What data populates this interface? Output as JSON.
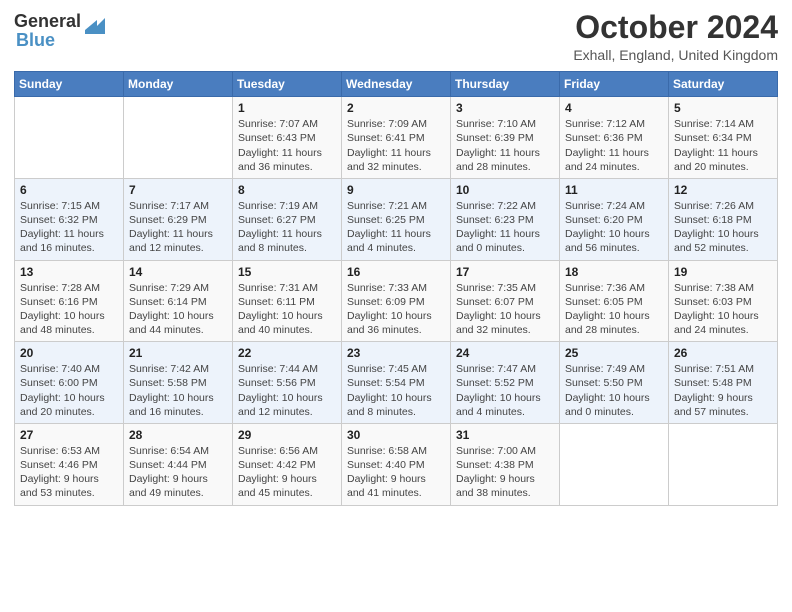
{
  "header": {
    "logo_line1": "General",
    "logo_line2": "Blue",
    "month": "October 2024",
    "location": "Exhall, England, United Kingdom"
  },
  "weekdays": [
    "Sunday",
    "Monday",
    "Tuesday",
    "Wednesday",
    "Thursday",
    "Friday",
    "Saturday"
  ],
  "weeks": [
    [
      {
        "day": "",
        "info": ""
      },
      {
        "day": "",
        "info": ""
      },
      {
        "day": "1",
        "info": "Sunrise: 7:07 AM\nSunset: 6:43 PM\nDaylight: 11 hours and 36 minutes."
      },
      {
        "day": "2",
        "info": "Sunrise: 7:09 AM\nSunset: 6:41 PM\nDaylight: 11 hours and 32 minutes."
      },
      {
        "day": "3",
        "info": "Sunrise: 7:10 AM\nSunset: 6:39 PM\nDaylight: 11 hours and 28 minutes."
      },
      {
        "day": "4",
        "info": "Sunrise: 7:12 AM\nSunset: 6:36 PM\nDaylight: 11 hours and 24 minutes."
      },
      {
        "day": "5",
        "info": "Sunrise: 7:14 AM\nSunset: 6:34 PM\nDaylight: 11 hours and 20 minutes."
      }
    ],
    [
      {
        "day": "6",
        "info": "Sunrise: 7:15 AM\nSunset: 6:32 PM\nDaylight: 11 hours and 16 minutes."
      },
      {
        "day": "7",
        "info": "Sunrise: 7:17 AM\nSunset: 6:29 PM\nDaylight: 11 hours and 12 minutes."
      },
      {
        "day": "8",
        "info": "Sunrise: 7:19 AM\nSunset: 6:27 PM\nDaylight: 11 hours and 8 minutes."
      },
      {
        "day": "9",
        "info": "Sunrise: 7:21 AM\nSunset: 6:25 PM\nDaylight: 11 hours and 4 minutes."
      },
      {
        "day": "10",
        "info": "Sunrise: 7:22 AM\nSunset: 6:23 PM\nDaylight: 11 hours and 0 minutes."
      },
      {
        "day": "11",
        "info": "Sunrise: 7:24 AM\nSunset: 6:20 PM\nDaylight: 10 hours and 56 minutes."
      },
      {
        "day": "12",
        "info": "Sunrise: 7:26 AM\nSunset: 6:18 PM\nDaylight: 10 hours and 52 minutes."
      }
    ],
    [
      {
        "day": "13",
        "info": "Sunrise: 7:28 AM\nSunset: 6:16 PM\nDaylight: 10 hours and 48 minutes."
      },
      {
        "day": "14",
        "info": "Sunrise: 7:29 AM\nSunset: 6:14 PM\nDaylight: 10 hours and 44 minutes."
      },
      {
        "day": "15",
        "info": "Sunrise: 7:31 AM\nSunset: 6:11 PM\nDaylight: 10 hours and 40 minutes."
      },
      {
        "day": "16",
        "info": "Sunrise: 7:33 AM\nSunset: 6:09 PM\nDaylight: 10 hours and 36 minutes."
      },
      {
        "day": "17",
        "info": "Sunrise: 7:35 AM\nSunset: 6:07 PM\nDaylight: 10 hours and 32 minutes."
      },
      {
        "day": "18",
        "info": "Sunrise: 7:36 AM\nSunset: 6:05 PM\nDaylight: 10 hours and 28 minutes."
      },
      {
        "day": "19",
        "info": "Sunrise: 7:38 AM\nSunset: 6:03 PM\nDaylight: 10 hours and 24 minutes."
      }
    ],
    [
      {
        "day": "20",
        "info": "Sunrise: 7:40 AM\nSunset: 6:00 PM\nDaylight: 10 hours and 20 minutes."
      },
      {
        "day": "21",
        "info": "Sunrise: 7:42 AM\nSunset: 5:58 PM\nDaylight: 10 hours and 16 minutes."
      },
      {
        "day": "22",
        "info": "Sunrise: 7:44 AM\nSunset: 5:56 PM\nDaylight: 10 hours and 12 minutes."
      },
      {
        "day": "23",
        "info": "Sunrise: 7:45 AM\nSunset: 5:54 PM\nDaylight: 10 hours and 8 minutes."
      },
      {
        "day": "24",
        "info": "Sunrise: 7:47 AM\nSunset: 5:52 PM\nDaylight: 10 hours and 4 minutes."
      },
      {
        "day": "25",
        "info": "Sunrise: 7:49 AM\nSunset: 5:50 PM\nDaylight: 10 hours and 0 minutes."
      },
      {
        "day": "26",
        "info": "Sunrise: 7:51 AM\nSunset: 5:48 PM\nDaylight: 9 hours and 57 minutes."
      }
    ],
    [
      {
        "day": "27",
        "info": "Sunrise: 6:53 AM\nSunset: 4:46 PM\nDaylight: 9 hours and 53 minutes."
      },
      {
        "day": "28",
        "info": "Sunrise: 6:54 AM\nSunset: 4:44 PM\nDaylight: 9 hours and 49 minutes."
      },
      {
        "day": "29",
        "info": "Sunrise: 6:56 AM\nSunset: 4:42 PM\nDaylight: 9 hours and 45 minutes."
      },
      {
        "day": "30",
        "info": "Sunrise: 6:58 AM\nSunset: 4:40 PM\nDaylight: 9 hours and 41 minutes."
      },
      {
        "day": "31",
        "info": "Sunrise: 7:00 AM\nSunset: 4:38 PM\nDaylight: 9 hours and 38 minutes."
      },
      {
        "day": "",
        "info": ""
      },
      {
        "day": "",
        "info": ""
      }
    ]
  ]
}
